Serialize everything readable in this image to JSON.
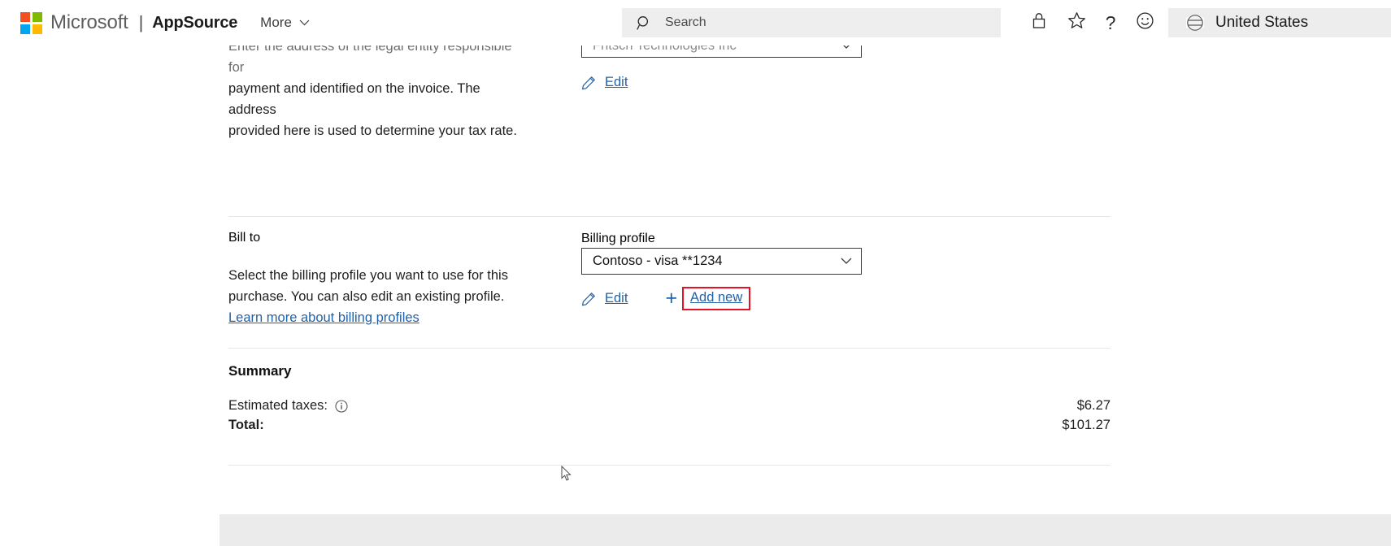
{
  "header": {
    "logo_name": "microsoft-logo",
    "company": "Microsoft",
    "separator": "|",
    "brand": "AppSource",
    "more_label": "More",
    "search_placeholder": "Search",
    "search_value": "",
    "icons": [
      "lock-icon",
      "star-icon",
      "help-icon",
      "smiley-icon"
    ],
    "help_glyph": "?",
    "region_label": "United States",
    "region_icon": "globe-icon"
  },
  "sell_to_section": {
    "description_line1": "Enter the address of the legal entity responsible for",
    "description_line2": "payment and identified on the invoice. The address",
    "description_line3": "provided here is used to determine your tax rate.",
    "selected_entity": "Fritsch Technologies Inc",
    "edit_label": "Edit"
  },
  "bill_to_section": {
    "heading": "Bill to",
    "description_part1": "Select the billing profile you want to use for this purchase. You can also edit an existing profile. ",
    "description_link": "Learn more about billing profiles",
    "field_label": "Billing profile",
    "selected_profile": "Contoso - visa **1234",
    "edit_label": "Edit",
    "add_new_label": "Add new",
    "plus_glyph": "+",
    "highlight_color": "#e81123"
  },
  "summary_section": {
    "heading": "Summary",
    "rows": [
      {
        "label": "Estimated taxes:",
        "amount": "$6.27",
        "bold": false,
        "has_info": true
      },
      {
        "label": "Total:",
        "amount": "$101.27",
        "bold": true,
        "has_info": false
      }
    ]
  },
  "colors": {
    "link": "#2362a6",
    "accent_red": "#e81123",
    "nav_bg": "#ffffff",
    "search_bg": "#eeeeee"
  }
}
